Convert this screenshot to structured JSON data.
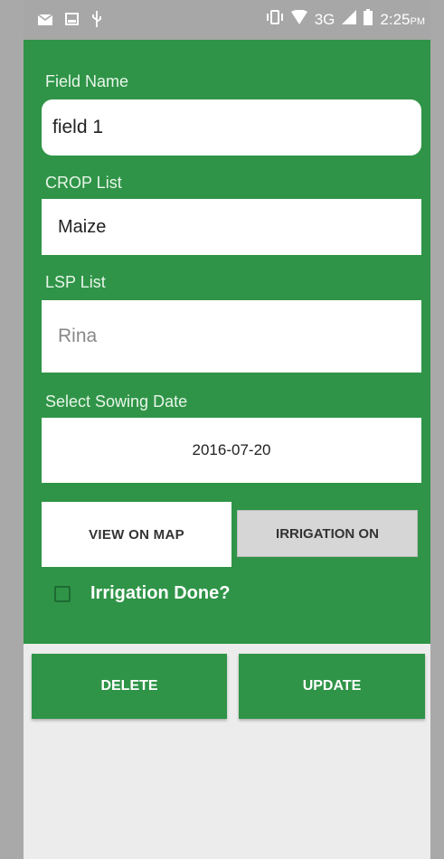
{
  "status_bar": {
    "icons_left": [
      "mail-icon",
      "image-icon",
      "usb-icon"
    ],
    "icons_right": [
      "vibrate-icon",
      "wifi-icon"
    ],
    "network": "3G",
    "time": "2:25",
    "ampm": "PM"
  },
  "form": {
    "field_name_label": "Field Name",
    "field_name_value": "field 1",
    "crop_label": "CROP List",
    "crop_value": "Maize",
    "lsp_label": "LSP List",
    "lsp_value": "Rina",
    "sowing_label": "Select Sowing Date",
    "sowing_value": "2016-07-20",
    "view_map_label": "VIEW ON MAP",
    "irrigation_on_label": "IRRIGATION ON",
    "irrigation_done_label": "Irrigation Done?",
    "irrigation_done_checked": false
  },
  "actions": {
    "delete_label": "DELETE",
    "update_label": "UPDATE"
  },
  "colors": {
    "accent_green": "#2f9447",
    "page_bg": "#ececec"
  }
}
